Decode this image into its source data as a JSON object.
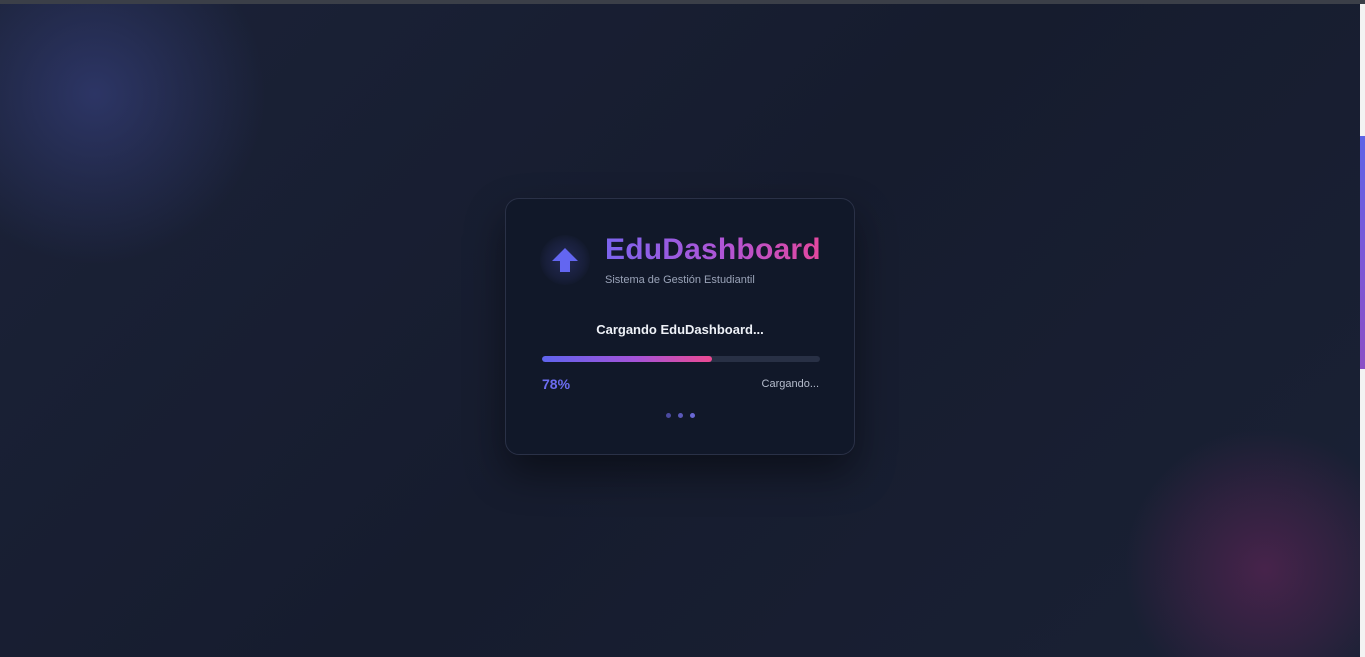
{
  "brand": {
    "title": "EduDashboard",
    "subtitle": "Sistema de Gestión Estudiantil",
    "logo_icon": "arrow-up-icon",
    "accent_color": "#6366f1",
    "secondary_color": "#ec4899"
  },
  "loader": {
    "title": "Cargando EduDashboard...",
    "percent_label": "78%",
    "status": "Cargando...",
    "progress_fill": 0.61,
    "dots_icon": "loading-dots-icon"
  }
}
